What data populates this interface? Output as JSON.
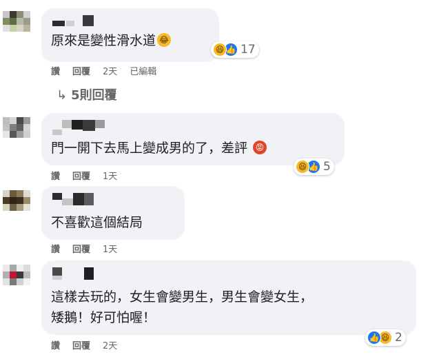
{
  "comments": [
    {
      "text_lines": [
        "原來是變性滑水道"
      ],
      "reaction_count": "17",
      "actions": {
        "like": "讚",
        "reply": "回覆",
        "time": "2天",
        "edited": "已編輯"
      }
    },
    {
      "text_lines": [
        "門一開下去馬上變成男的了，差評"
      ],
      "reaction_count": "5",
      "actions": {
        "like": "讚",
        "reply": "回覆",
        "time": "1天"
      }
    },
    {
      "text_lines": [
        "不喜歡這個結局"
      ],
      "actions": {
        "like": "讚",
        "reply": "回覆",
        "time": "1天"
      }
    },
    {
      "text_lines": [
        "這樣去玩的，女生會變男生，男生會變女生，",
        "矮鵝！好可怕喔！"
      ],
      "reaction_count": "2",
      "actions": {
        "like": "讚",
        "reply": "回覆",
        "time": "2天"
      }
    }
  ],
  "replies_link": {
    "arrow": "↳",
    "label": "5則回覆"
  },
  "icons": {
    "haha": "haha-reaction-icon",
    "like": "like-reaction-icon",
    "laughing_emoji": "rofl-emoji-icon",
    "angry_emoji": "angry-emoji-icon"
  },
  "colors": {
    "bubble": "#f0f2f5",
    "like_blue": "#1877f2",
    "haha_yellow": "#f7b928",
    "meta_gray": "#65676b"
  }
}
